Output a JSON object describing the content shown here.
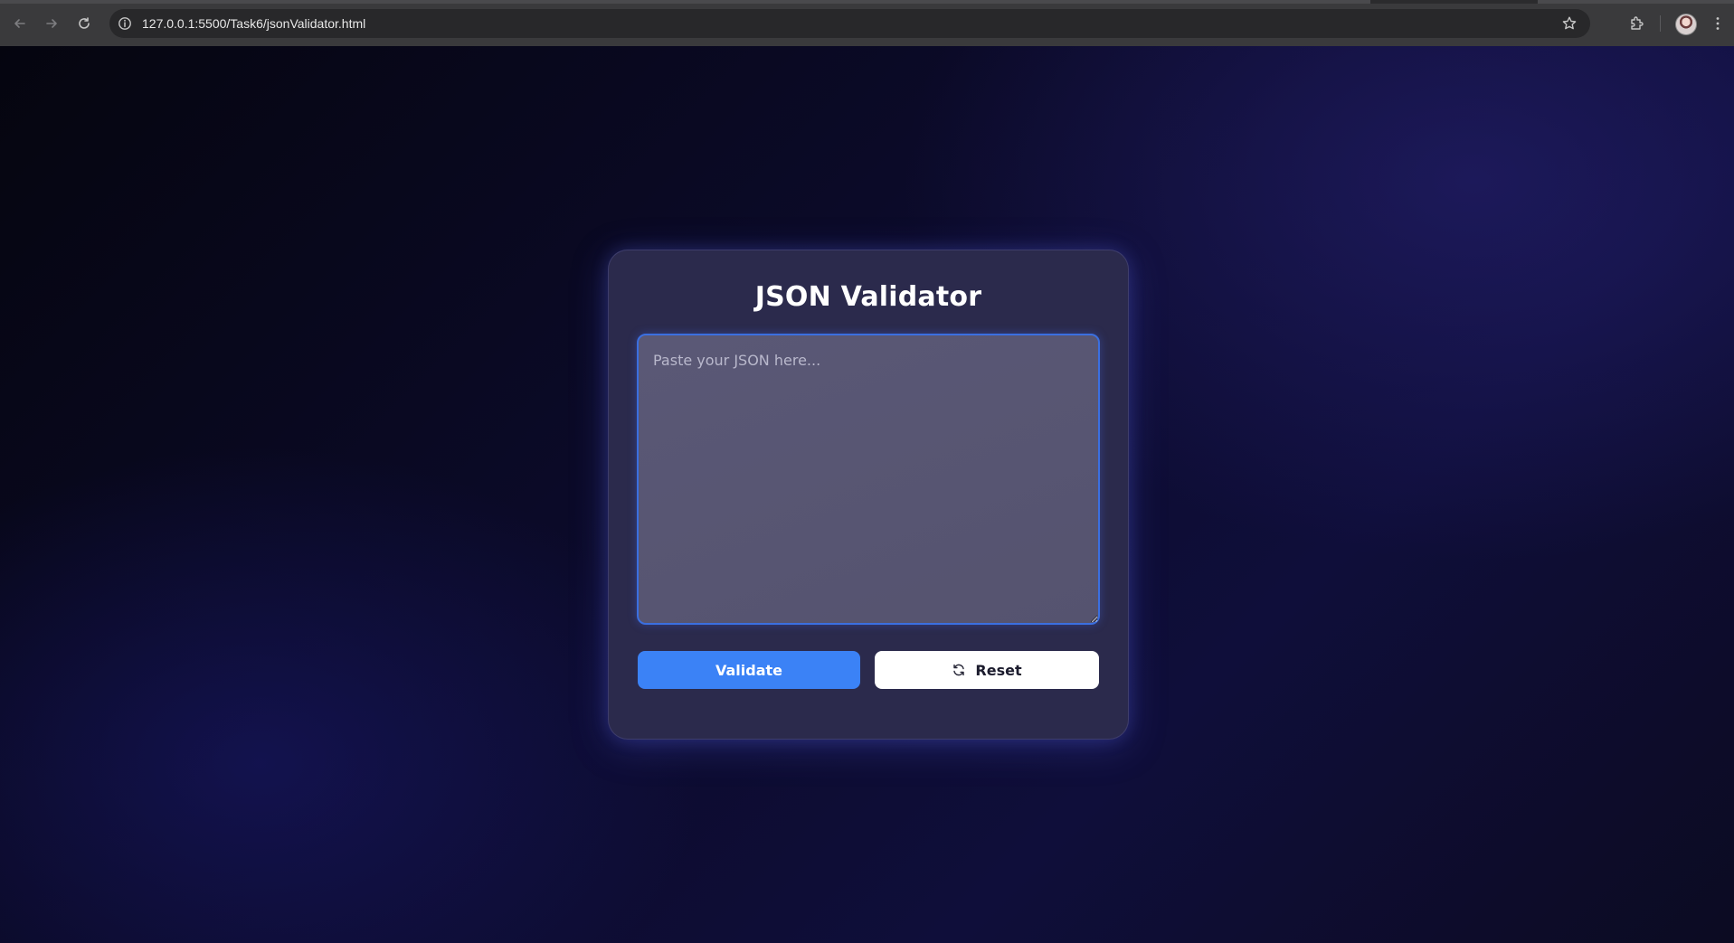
{
  "browser": {
    "url": "127.0.0.1:5500/Task6/jsonValidator.html",
    "icons": [
      "back-icon",
      "forward-icon",
      "reload-icon",
      "site-info-icon",
      "bookmark-star-icon",
      "extensions-icon",
      "profile-avatar",
      "menu-icon"
    ]
  },
  "app": {
    "title": "JSON Validator",
    "input": {
      "value": "",
      "placeholder": "Paste your JSON here..."
    },
    "buttons": {
      "validate_label": "Validate",
      "reset_label": "Reset"
    }
  },
  "colors": {
    "accent": "#3b82f6",
    "input_border": "#3b6fe0",
    "card_bg": "#2b2a4c"
  }
}
